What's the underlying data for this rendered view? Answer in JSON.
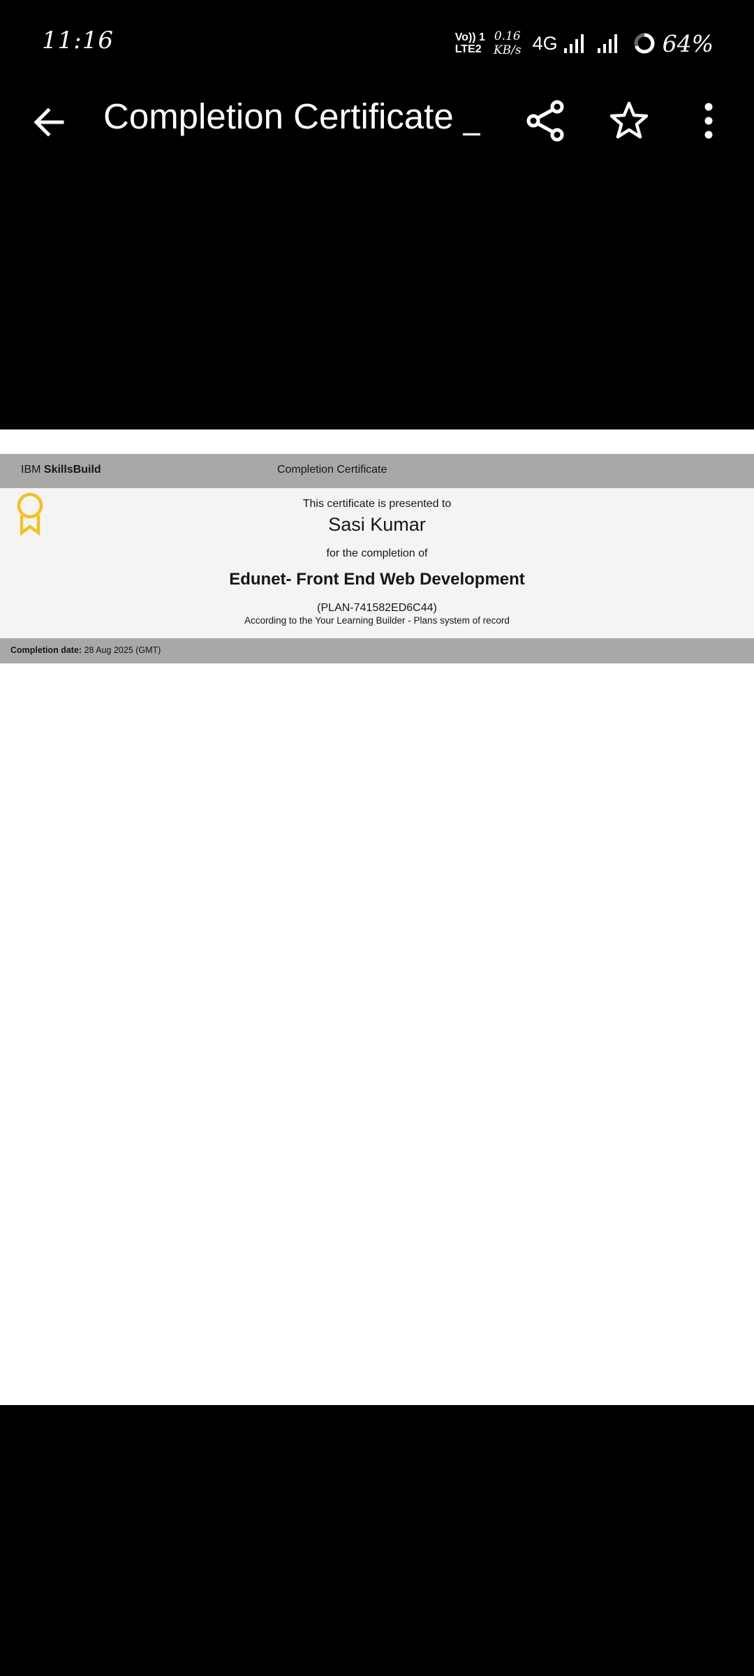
{
  "status_bar": {
    "time": "11:16",
    "volte_line1": "Vo)) 1",
    "volte_line2": "LTE2",
    "speed_value": "0.16",
    "speed_unit": "KB/s",
    "network": "4G",
    "battery": "64%"
  },
  "app_bar": {
    "title": "Completion Certificate _...",
    "icons": [
      "back-arrow-icon",
      "share-icon",
      "star-icon",
      "more-vert-icon"
    ]
  },
  "certificate": {
    "brand_prefix": "IBM ",
    "brand_name": "SkillsBuild",
    "header_title": "Completion Certificate",
    "presented_to": "This certificate is presented to",
    "recipient": "Sasi Kumar",
    "completion_of": "for the completion of",
    "course": "Edunet- Front End Web Development",
    "plan": "(PLAN-741582ED6C44)",
    "record": "According to the Your Learning Builder - Plans system of record",
    "completion_date_label": "Completion date:",
    "completion_date": " 28 Aug 2025 (GMT)"
  },
  "colors": {
    "badge": "#f1c21b",
    "band": "#a8a8a8",
    "body_bg": "#f4f4f4"
  }
}
